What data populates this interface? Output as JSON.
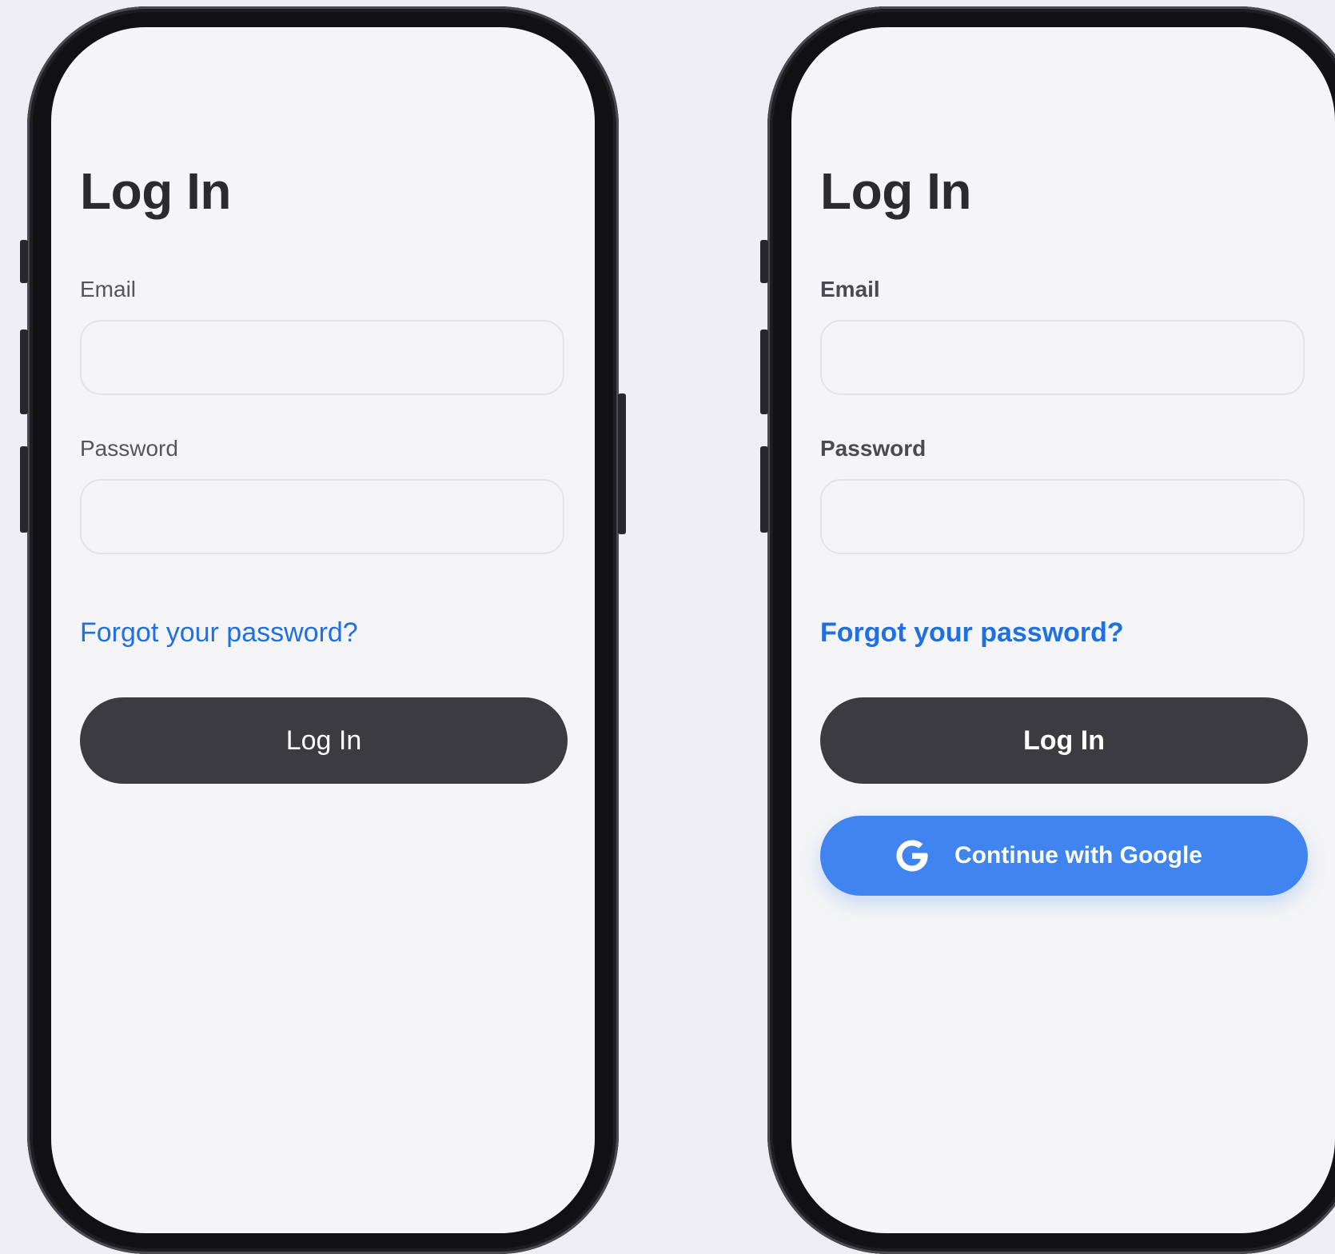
{
  "screens": [
    {
      "title": "Log In",
      "email_label": "Email",
      "email_value": "",
      "password_label": "Password",
      "password_value": "",
      "forgot_link": "Forgot your password?",
      "login_button": "Log In"
    },
    {
      "title": "Log In",
      "email_label": "Email",
      "email_value": "",
      "password_label": "Password",
      "password_value": "",
      "forgot_link": "Forgot your password?",
      "login_button": "Log In",
      "google_button": "Continue with Google",
      "google_icon": "google-g-icon"
    }
  ],
  "colors": {
    "background": "#efeff3",
    "screen": "#f5f5f7",
    "link": "#1f6fe5",
    "primary_button": "#3c3c40",
    "google_button": "#4085ef"
  }
}
